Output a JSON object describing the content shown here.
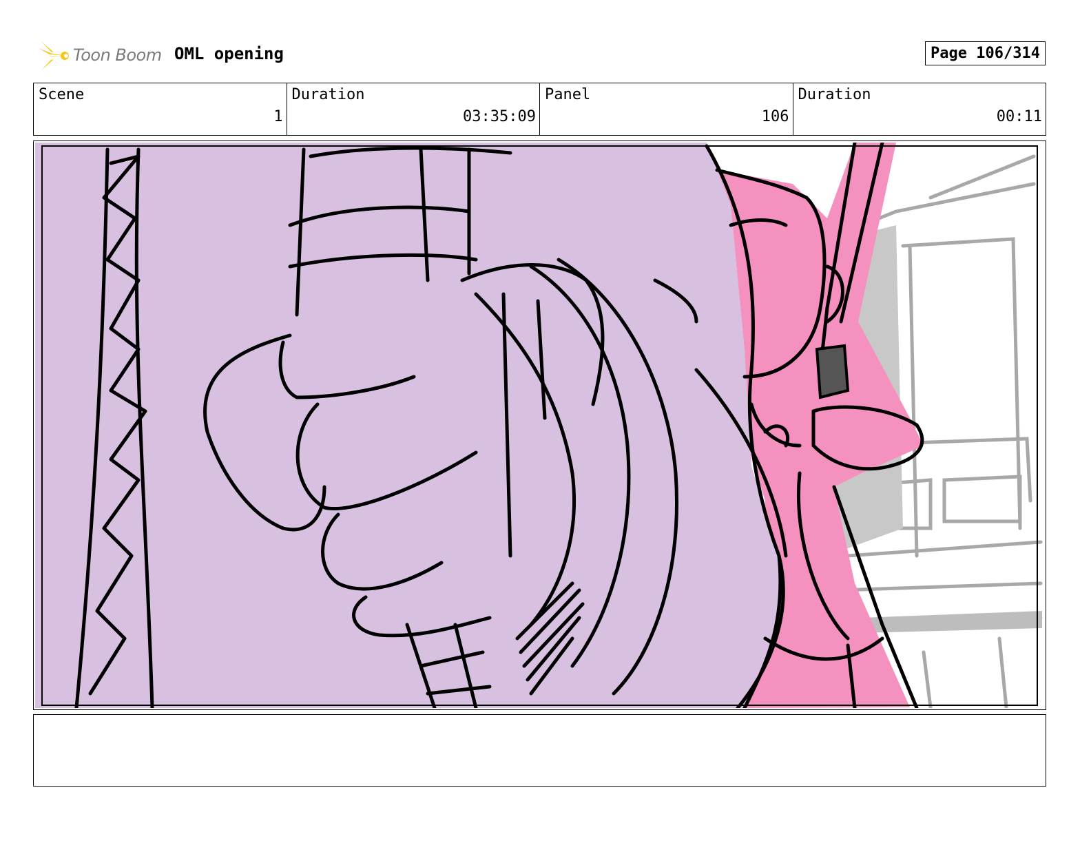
{
  "header": {
    "logo_text": "Toon Boom",
    "project_title": "OML opening",
    "page_label": "Page 106/314"
  },
  "info": {
    "scene_label": "Scene",
    "scene_value": "1",
    "duration_label": "Duration",
    "duration_value": "03:35:09",
    "panel_label": "Panel",
    "panel_value": "106",
    "panel_duration_label": "Duration",
    "panel_duration_value": "00:11"
  },
  "colors": {
    "logo_star": "#f5c518",
    "purple_fill": "#d8c0e0",
    "pink_fill": "#f591bf",
    "gray_fill": "#c8c8c8",
    "line": "#000000"
  },
  "notes": {
    "text": ""
  }
}
